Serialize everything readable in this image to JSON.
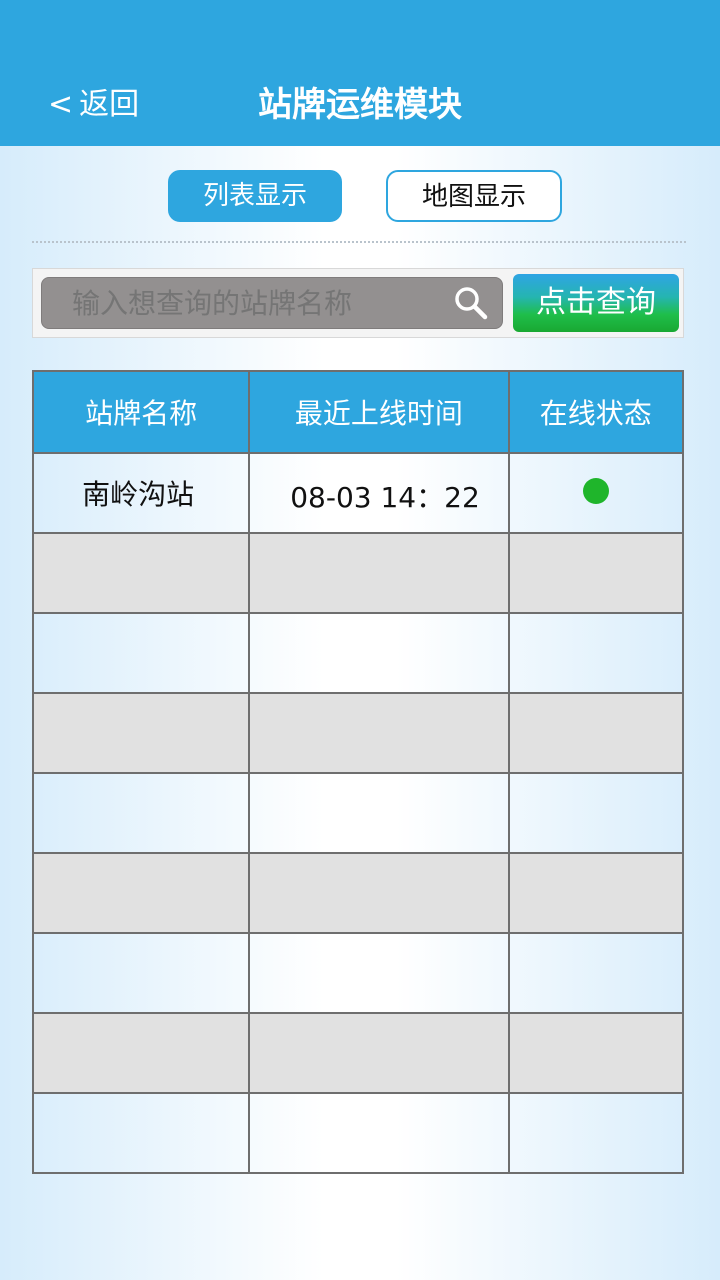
{
  "header": {
    "back_label": "返回",
    "back_chevron": "<",
    "title": "站牌运维模块"
  },
  "view_toggle": {
    "list_label": "列表显示",
    "map_label": "地图显示",
    "selected": "列表显示"
  },
  "search": {
    "placeholder": "输入想查询的站牌名称",
    "value": "",
    "button_label": "点击查询",
    "icon": "search-icon"
  },
  "table": {
    "columns": [
      "站牌名称",
      "最近上线时间",
      "在线状态"
    ],
    "rows": [
      {
        "name": "南岭沟站",
        "last_online": "08-03  14：22",
        "status": "online",
        "status_color": "#1fb52b"
      },
      {
        "name": "",
        "last_online": "",
        "status": ""
      },
      {
        "name": "",
        "last_online": "",
        "status": ""
      },
      {
        "name": "",
        "last_online": "",
        "status": ""
      },
      {
        "name": "",
        "last_online": "",
        "status": ""
      },
      {
        "name": "",
        "last_online": "",
        "status": ""
      },
      {
        "name": "",
        "last_online": "",
        "status": ""
      },
      {
        "name": "",
        "last_online": "",
        "status": ""
      },
      {
        "name": "",
        "last_online": "",
        "status": ""
      }
    ]
  },
  "colors": {
    "header_bg": "#2ea6df",
    "online_green": "#1fb52b",
    "search_button_green": "#1fbe4a"
  }
}
